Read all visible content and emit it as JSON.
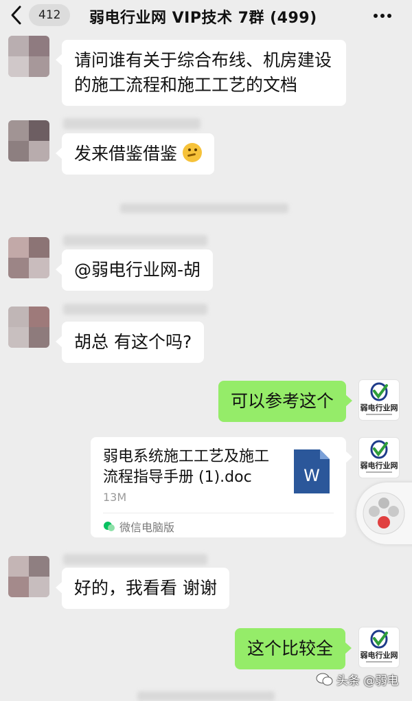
{
  "header": {
    "back_count": "412",
    "title": "弱电行业网 VIP技术 7群 (499)",
    "more_icon": "more-dots-icon"
  },
  "messages": [
    {
      "side": "left",
      "text": "请问谁有关于综合布线、机房建设的施工流程和施工工艺的文档"
    },
    {
      "side": "left",
      "text": "发来借鉴借鉴",
      "emoji": "thinking-face-emoji"
    },
    {
      "side": "left",
      "text": "@弱电行业网-胡"
    },
    {
      "side": "left",
      "text": "胡总 有这个吗?"
    },
    {
      "side": "right",
      "text": "可以参考这个"
    },
    {
      "side": "right",
      "type": "file",
      "file_name": "弱电系统施工工艺及施工流程指导手册 (1).doc",
      "file_size": "13M",
      "file_type_letter": "W",
      "source": "微信电脑版"
    },
    {
      "side": "left",
      "text": "好的，我看看 谢谢"
    },
    {
      "side": "right",
      "text": "这个比较全"
    }
  ],
  "logo_avatar": {
    "text": "弱电行业网"
  },
  "watermark": {
    "text": "头条 @弱电"
  },
  "colors": {
    "background": "#ededed",
    "bubble_self": "#95ec69",
    "bubble_other": "#ffffff",
    "word_blue": "#2b579a",
    "wechat_green": "#07c160"
  }
}
